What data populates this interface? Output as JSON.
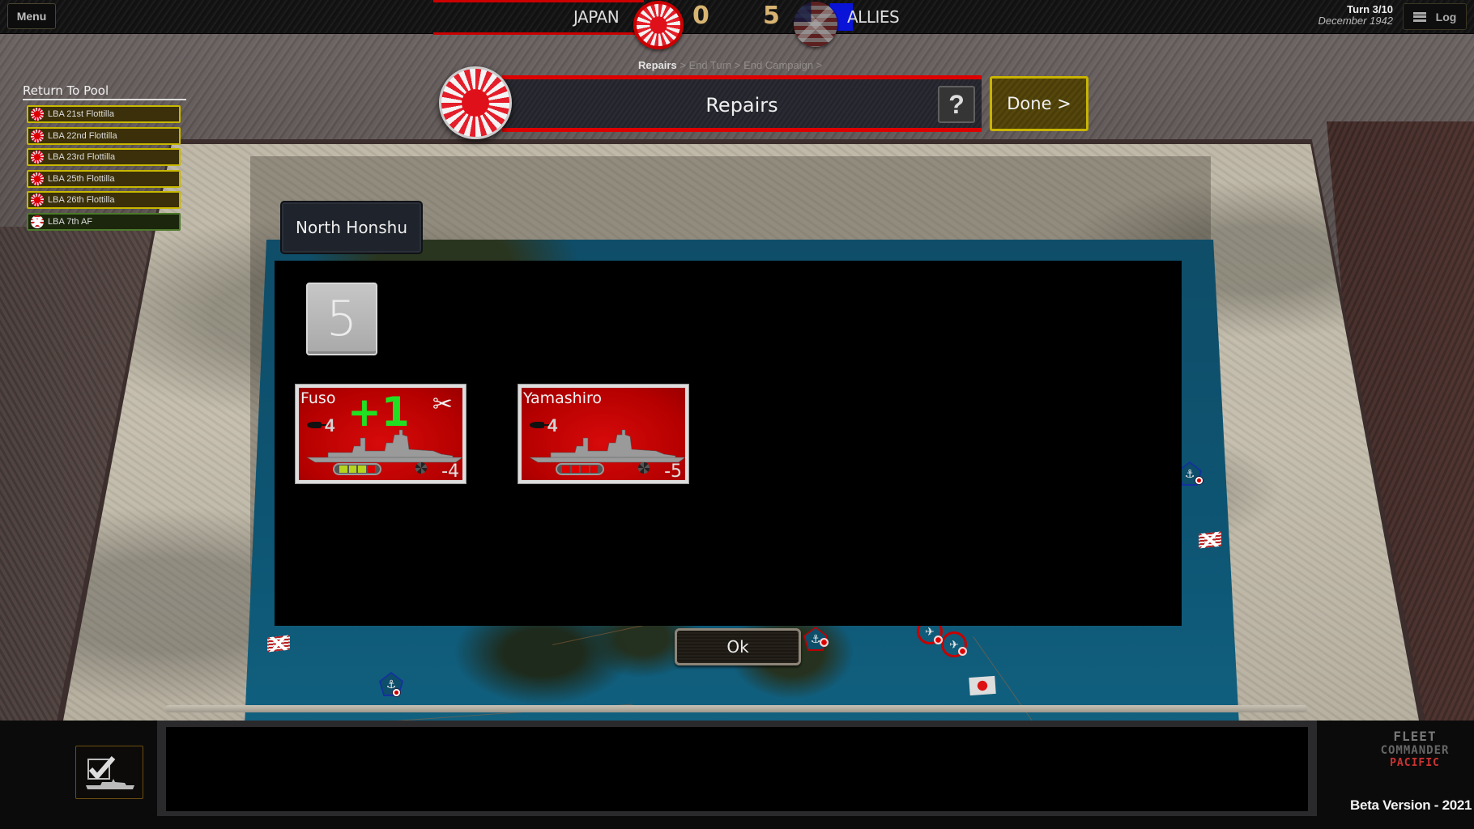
{
  "topbar": {
    "menu_label": "Menu",
    "team_left": "JAPAN",
    "team_left_score": "0",
    "team_right_score": "5",
    "team_right": "ALLIES",
    "turn": "Turn 3/10",
    "date": "December 1942",
    "log_label": "Log"
  },
  "phases": {
    "current": "Repairs",
    "rest": " > End Turn > End Campaign >"
  },
  "phase_header": {
    "title": "Repairs",
    "help_label": "?",
    "done_label": "Done >"
  },
  "pool": {
    "title": "Return To Pool",
    "items": [
      {
        "label": "LBA 21st Flottilla",
        "side": "japan"
      },
      {
        "label": "LBA 22nd Flottilla",
        "side": "japan"
      },
      {
        "label": "LBA 23rd Flottilla",
        "side": "japan"
      },
      {
        "label": "LBA 25th Flottilla",
        "side": "japan"
      },
      {
        "label": "LBA 26th Flottilla",
        "side": "japan"
      },
      {
        "label": "LBA 7th AF",
        "side": "allies"
      }
    ]
  },
  "dialog": {
    "region": "North Honshu",
    "die_value": "5",
    "ships": [
      {
        "name": "Fuso",
        "attack": "4",
        "defense": "-4",
        "repair": "+1",
        "health_full": 3,
        "health_total": 4,
        "repairable": true
      },
      {
        "name": "Yamashiro",
        "attack": "4",
        "defense": "-5",
        "repair": "",
        "health_full": 0,
        "health_total": 4,
        "repairable": false
      }
    ],
    "ok_label": "Ok"
  },
  "colors": {
    "japan_red": "#cc0000",
    "allies_blue": "#0a14d8",
    "score_gold": "#d8b472",
    "done_border": "#c8b400",
    "repair_green": "#21e021",
    "health_full": "#b5d41e"
  },
  "footer": {
    "logo_line1": "FLEET",
    "logo_line2": "COMMANDER",
    "logo_line3": "PACIFIC",
    "version": "Beta Version - 2021"
  }
}
